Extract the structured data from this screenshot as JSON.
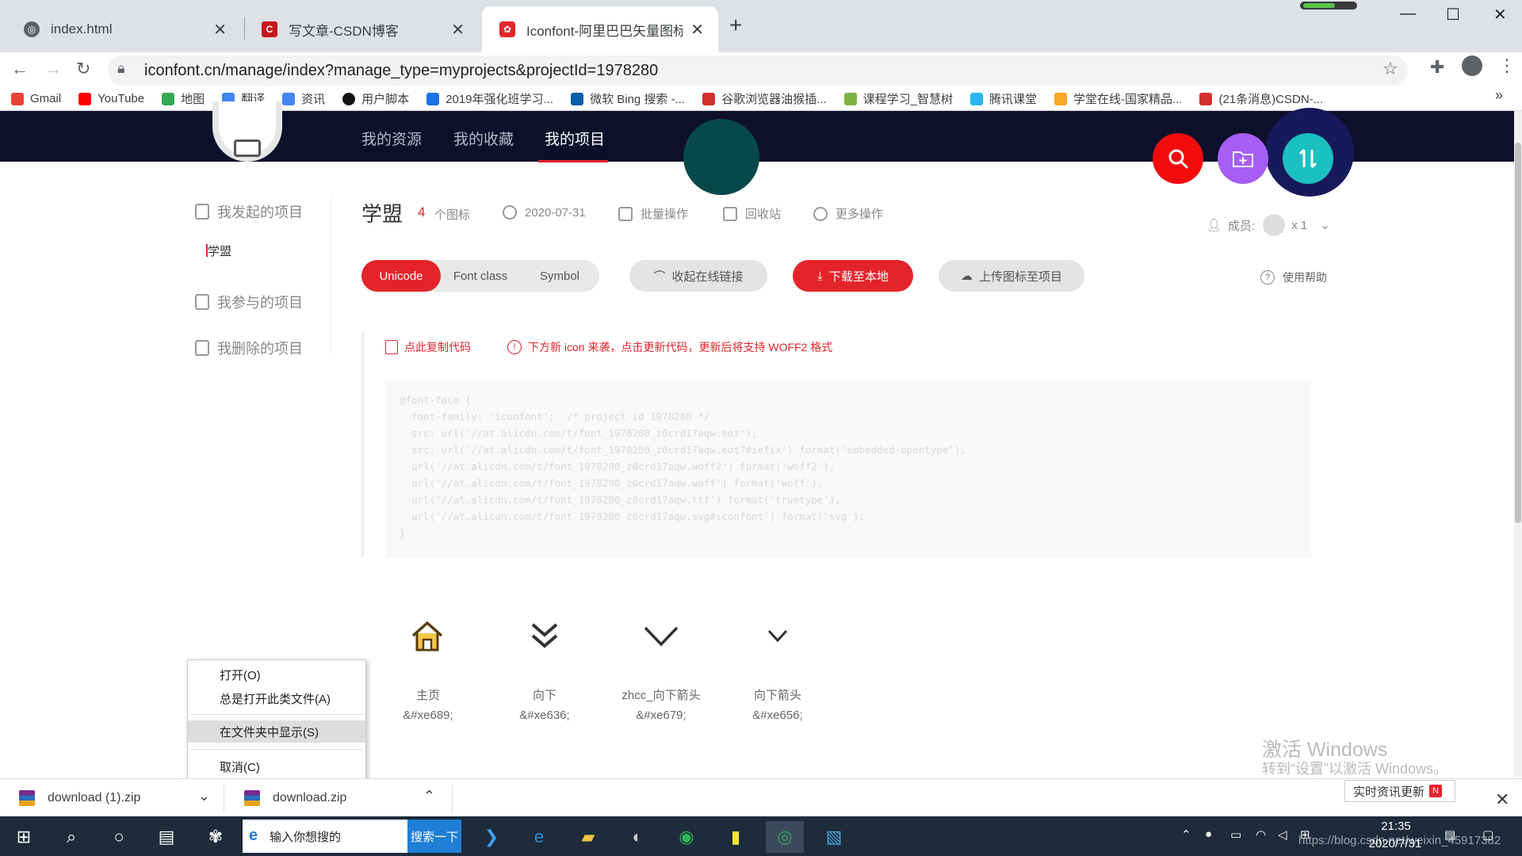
{
  "browser": {
    "tabs": [
      {
        "label": "index.html",
        "active": false
      },
      {
        "label": "写文章-CSDN博客",
        "active": false
      },
      {
        "label": "Iconfont-阿里巴巴矢量图标库",
        "active": true
      }
    ],
    "url": "iconfont.cn/manage/index?manage_type=myprojects&projectId=1978280",
    "bookmarks": [
      {
        "label": "Gmail",
        "color": "#ea4335"
      },
      {
        "label": "YouTube",
        "color": "#ff0000"
      },
      {
        "label": "地图",
        "color": "#34a853"
      },
      {
        "label": "翻译",
        "color": "#4285f4"
      },
      {
        "label": "资讯",
        "color": "#4285f4"
      },
      {
        "label": "用户脚本",
        "color": "#111111"
      },
      {
        "label": "2019年强化班学习...",
        "color": "#1a73e8"
      },
      {
        "label": "微软 Bing 搜索 -...",
        "color": "#0b5ea8"
      },
      {
        "label": "谷歌浏览器油猴插...",
        "color": "#d32f2f"
      },
      {
        "label": "课程学习_智慧树",
        "color": "#7cb342"
      },
      {
        "label": "腾讯课堂",
        "color": "#29b6f6"
      },
      {
        "label": "学堂在线-国家精品...",
        "color": "#f9a825"
      },
      {
        "label": "(21条消息)CSDN-...",
        "color": "#d32f2f"
      }
    ],
    "bookmarks_overflow": "»"
  },
  "site": {
    "nav": [
      {
        "label": "我的资源",
        "active": false
      },
      {
        "label": "我的收藏",
        "active": false
      },
      {
        "label": "我的项目",
        "active": true
      }
    ],
    "accent": "#e4242b"
  },
  "sidebar": {
    "sections": [
      "我发起的项目",
      "我参与的项目",
      "我删除的项目"
    ],
    "sub_item": "学盟"
  },
  "project": {
    "title": "学盟",
    "count": "4",
    "count_unit": "个图标",
    "date": "2020-07-31",
    "batch": "批量操作",
    "recycle": "回收站",
    "more": "更多操作",
    "members_label": "成员:",
    "members_count": "x 1"
  },
  "buttons": {
    "seg": [
      "Unicode",
      "Font class",
      "Symbol"
    ],
    "collapse_link": "收起在线链接",
    "download": "下载至本地",
    "upload": "上传图标至项目",
    "help": "使用帮助"
  },
  "code": {
    "copy": "点此复制代码",
    "notice": "下方新 icon 来袭，点击更新代码，更新后将支持 WOFF2 格式",
    "lines": [
      "@font-face {",
      "  font-family: 'iconfont';  /* project id 1978280 */",
      "  src: url('//at.alicdn.com/t/font_1978280_z0crd17aqw.eot');",
      "  src: url('//at.alicdn.com/t/font_1978280_z0crd17aqw.eot?#iefix') format('embedded-opentype'),",
      "  url('//at.alicdn.com/t/font_1978280_z0crd17aqw.woff2') format('woff2'),",
      "  url('//at.alicdn.com/t/font_1978280_z0crd17aqw.woff') format('woff'),",
      "  url('//at.alicdn.com/t/font_1978280_z0crd17aqw.ttf') format('truetype'),",
      "  url('//at.alicdn.com/t/font_1978280_z0crd17aqw.svg#iconfont') format('svg');",
      "}"
    ]
  },
  "icons": [
    {
      "name": "主页",
      "code": "&#xe689;",
      "icon": "home-icon"
    },
    {
      "name": "向下",
      "code": "&#xe636;",
      "icon": "double-chevron-down-icon"
    },
    {
      "name": "zhcc_向下箭头",
      "code": "&#xe679;",
      "icon": "chevron-down-icon"
    },
    {
      "name": "向下箭头",
      "code": "&#xe656;",
      "icon": "small-chevron-down-icon"
    }
  ],
  "context_menu": {
    "items": [
      "打开(O)",
      "总是打开此类文件(A)",
      "在文件夹中显示(S)",
      "取消(C)"
    ]
  },
  "downloads": [
    {
      "name": "download (1).zip"
    },
    {
      "name": "download.zip"
    }
  ],
  "watermark": {
    "line1": "激活 Windows",
    "line2": "转到“设置”以激活 Windows。"
  },
  "toast": {
    "text": "实时资讯更新",
    "badge": "N"
  },
  "taskbar": {
    "search_placeholder": "输入你想搜的",
    "search_button": "搜索一下",
    "time": "21:35",
    "date": "2020/7/31",
    "watermark_url": "https://blog.csdn.net/weixin_45917382"
  }
}
